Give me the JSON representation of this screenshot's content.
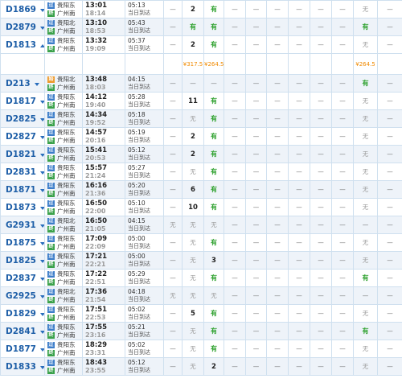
{
  "trains": [
    {
      "no": "D1869",
      "from": "贵阳东",
      "to": "广州南",
      "from_type": "pass",
      "dep": "13:01",
      "arr": "18:14",
      "dur": "05:13",
      "day": "当日到达",
      "seats": [
        "—",
        "2",
        "有",
        "—",
        "—",
        "—",
        "—",
        "—",
        "—",
        "无",
        "—"
      ],
      "arrow": "down"
    },
    {
      "no": "D2879",
      "from": "贵阳北",
      "to": "广州南",
      "from_type": "pass",
      "dep": "13:10",
      "arr": "18:53",
      "dur": "05:43",
      "day": "当日到达",
      "seats": [
        "—",
        "有",
        "有",
        "—",
        "—",
        "—",
        "—",
        "—",
        "—",
        "有",
        "—"
      ],
      "arrow": "down"
    },
    {
      "no": "D1813",
      "from": "贵阳东",
      "to": "广州南",
      "from_type": "pass",
      "dep": "13:32",
      "arr": "19:09",
      "dur": "05:37",
      "day": "当日到达",
      "seats": [
        "—",
        "2",
        "有",
        "—",
        "—",
        "—",
        "—",
        "—",
        "—",
        "无",
        "—"
      ],
      "arrow": "up"
    },
    {
      "no": "D213",
      "from": "贵阳北",
      "to": "广州南",
      "from_type": "start",
      "dep": "13:48",
      "arr": "18:03",
      "dur": "04:15",
      "day": "当日到达",
      "seats": [
        "—",
        "—",
        "—",
        "—",
        "—",
        "—",
        "—",
        "—",
        "—",
        "有",
        "—"
      ],
      "arrow": "down"
    },
    {
      "no": "D1817",
      "from": "贵阳东",
      "to": "广州南",
      "from_type": "pass",
      "dep": "14:12",
      "arr": "19:40",
      "dur": "05:28",
      "day": "当日到达",
      "seats": [
        "—",
        "11",
        "有",
        "—",
        "—",
        "—",
        "—",
        "—",
        "—",
        "无",
        "—"
      ],
      "arrow": "down"
    },
    {
      "no": "D2825",
      "from": "贵阳东",
      "to": "广州南",
      "from_type": "pass",
      "dep": "14:34",
      "arr": "19:52",
      "dur": "05:18",
      "day": "当日到达",
      "seats": [
        "—",
        "无",
        "有",
        "—",
        "—",
        "—",
        "—",
        "—",
        "—",
        "无",
        "—"
      ],
      "arrow": "down"
    },
    {
      "no": "D2827",
      "from": "贵阳东",
      "to": "广州南",
      "from_type": "pass",
      "dep": "14:57",
      "arr": "20:16",
      "dur": "05:19",
      "day": "当日到达",
      "seats": [
        "—",
        "2",
        "有",
        "—",
        "—",
        "—",
        "—",
        "—",
        "—",
        "无",
        "—"
      ],
      "arrow": "down"
    },
    {
      "no": "D1821",
      "from": "贵阳东",
      "to": "广州南",
      "from_type": "pass",
      "dep": "15:41",
      "arr": "20:53",
      "dur": "05:12",
      "day": "当日到达",
      "seats": [
        "—",
        "2",
        "有",
        "—",
        "—",
        "—",
        "—",
        "—",
        "—",
        "无",
        "—"
      ],
      "arrow": "down"
    },
    {
      "no": "D2831",
      "from": "贵阳东",
      "to": "广州南",
      "from_type": "pass",
      "dep": "15:57",
      "arr": "21:24",
      "dur": "05:27",
      "day": "当日到达",
      "seats": [
        "—",
        "无",
        "有",
        "—",
        "—",
        "—",
        "—",
        "—",
        "—",
        "无",
        "—"
      ],
      "arrow": "down"
    },
    {
      "no": "D1871",
      "from": "贵阳东",
      "to": "广州南",
      "from_type": "pass",
      "dep": "16:16",
      "arr": "21:36",
      "dur": "05:20",
      "day": "当日到达",
      "seats": [
        "—",
        "6",
        "有",
        "—",
        "—",
        "—",
        "—",
        "—",
        "—",
        "无",
        "—"
      ],
      "arrow": "down"
    },
    {
      "no": "D1873",
      "from": "贵阳东",
      "to": "广州南",
      "from_type": "pass",
      "dep": "16:50",
      "arr": "22:00",
      "dur": "05:10",
      "day": "当日到达",
      "seats": [
        "—",
        "10",
        "有",
        "—",
        "—",
        "—",
        "—",
        "—",
        "—",
        "无",
        "—"
      ],
      "arrow": "down"
    },
    {
      "no": "G2931",
      "from": "贵阳北",
      "to": "广州南",
      "from_type": "pass",
      "dep": "16:50",
      "arr": "21:05",
      "dur": "04:15",
      "day": "当日到达",
      "seats": [
        "无",
        "无",
        "无",
        "—",
        "—",
        "—",
        "—",
        "—",
        "—",
        "—",
        "—"
      ],
      "arrow": "down"
    },
    {
      "no": "D1875",
      "from": "贵阳东",
      "to": "广州南",
      "from_type": "pass",
      "dep": "17:09",
      "arr": "22:09",
      "dur": "05:00",
      "day": "当日到达",
      "seats": [
        "—",
        "无",
        "有",
        "—",
        "—",
        "—",
        "—",
        "—",
        "—",
        "无",
        "—"
      ],
      "arrow": "down"
    },
    {
      "no": "D1825",
      "from": "贵阳东",
      "to": "广州南",
      "from_type": "pass",
      "dep": "17:21",
      "arr": "22:21",
      "dur": "05:00",
      "day": "当日到达",
      "seats": [
        "—",
        "无",
        "3",
        "—",
        "—",
        "—",
        "—",
        "—",
        "—",
        "无",
        "—"
      ],
      "arrow": "down"
    },
    {
      "no": "D2837",
      "from": "贵阳东",
      "to": "广州南",
      "from_type": "pass",
      "dep": "17:22",
      "arr": "22:51",
      "dur": "05:29",
      "day": "当日到达",
      "seats": [
        "—",
        "无",
        "有",
        "—",
        "—",
        "—",
        "—",
        "—",
        "—",
        "有",
        "—"
      ],
      "arrow": "down"
    },
    {
      "no": "G2925",
      "from": "贵阳北",
      "to": "广州南",
      "from_type": "pass",
      "dep": "17:36",
      "arr": "21:54",
      "dur": "04:18",
      "day": "当日到达",
      "seats": [
        "无",
        "无",
        "无",
        "—",
        "—",
        "—",
        "—",
        "—",
        "—",
        "—",
        "—"
      ],
      "arrow": "down"
    },
    {
      "no": "D1829",
      "from": "贵阳东",
      "to": "广州南",
      "from_type": "pass",
      "dep": "17:51",
      "arr": "22:53",
      "dur": "05:02",
      "day": "当日到达",
      "seats": [
        "—",
        "5",
        "有",
        "—",
        "—",
        "—",
        "—",
        "—",
        "—",
        "无",
        "—"
      ],
      "arrow": "down"
    },
    {
      "no": "D2841",
      "from": "贵阳东",
      "to": "广州南",
      "from_type": "pass",
      "dep": "17:55",
      "arr": "23:16",
      "dur": "05:21",
      "day": "当日到达",
      "seats": [
        "—",
        "无",
        "有",
        "—",
        "—",
        "—",
        "—",
        "—",
        "—",
        "有",
        "—"
      ],
      "arrow": "down"
    },
    {
      "no": "D1877",
      "from": "贵阳东",
      "to": "广州南",
      "from_type": "pass",
      "dep": "18:29",
      "arr": "23:31",
      "dur": "05:02",
      "day": "当日到达",
      "seats": [
        "—",
        "无",
        "有",
        "—",
        "—",
        "—",
        "—",
        "—",
        "—",
        "无",
        "—"
      ],
      "arrow": "down"
    },
    {
      "no": "D1833",
      "from": "贵阳东",
      "to": "广州南",
      "from_type": "pass",
      "dep": "18:43",
      "arr": "23:55",
      "dur": "05:12",
      "day": "当日到达",
      "seats": [
        "—",
        "无",
        "2",
        "—",
        "—",
        "—",
        "—",
        "—",
        "—",
        "无",
        "—"
      ],
      "arrow": "down"
    }
  ],
  "price_row": {
    "after_index": 2,
    "cells": [
      "",
      "¥317.5",
      "¥264.5",
      "",
      "",
      "",
      "",
      "",
      "",
      "¥264.5",
      ""
    ]
  },
  "station_badges": {
    "start": "始",
    "pass": "过",
    "end": "终"
  },
  "colors": {
    "train_no": "#1d5ea7",
    "available": "#2ca02c",
    "price": "#f08a00",
    "border": "#cfe0ef",
    "alt_row": "#eef3f9"
  }
}
